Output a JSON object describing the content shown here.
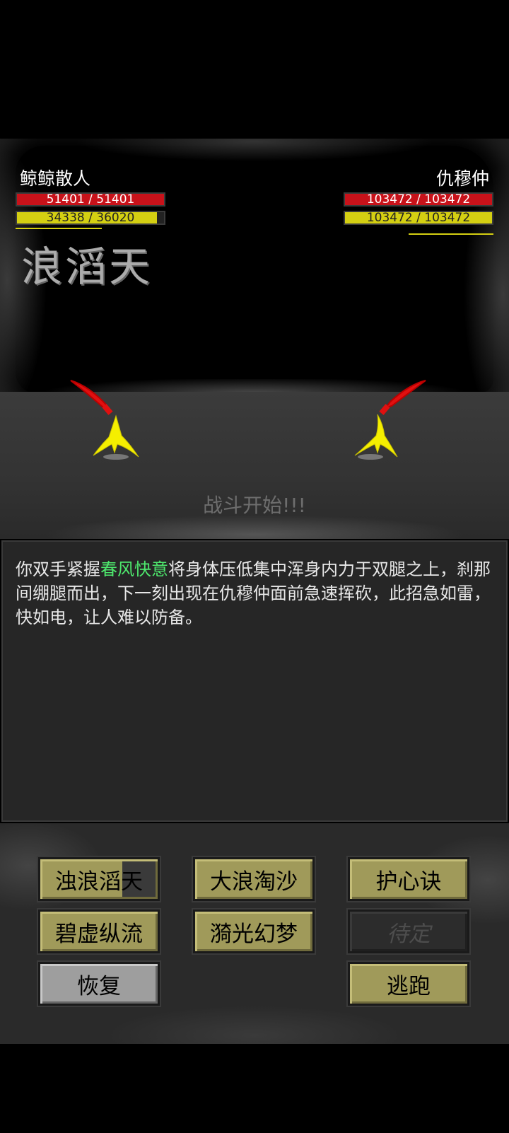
{
  "player": {
    "name": "鲸鲸散人",
    "hp": "51401 / 51401",
    "hp_fraction": 1.0,
    "mp": "34338 / 36020",
    "mp_fraction": 0.953,
    "colors": {
      "hp": "#c8121a",
      "mp": "#d4cf12"
    }
  },
  "enemy": {
    "name": "仇穆仲",
    "hp": "103472 / 103472",
    "hp_fraction": 1.0,
    "mp": "103472 / 103472",
    "mp_fraction": 1.0
  },
  "skill_banner": "浪滔天",
  "battle_status": "战斗开始!!!",
  "message": {
    "before": "你双手紧握",
    "highlight": "春风快意",
    "after": "将身体压低集中浑身内力于双腿之上，刹那间绷腿而出，下一刻出现在仇穆仲面前急速挥砍，此招急如雷，快如电，让人难以防备。",
    "highlight_color": "#4ee86d"
  },
  "buttons": {
    "skill1": "浊浪滔天",
    "skill2": "大浪淘沙",
    "skill3": "护心诀",
    "skill4": "碧虚纵流",
    "skill5": "漪光幻梦",
    "skill6": "待定",
    "recover": "恢复",
    "flee": "逃跑"
  },
  "icons": {
    "player_sprite": "yellow-swordsman-icon",
    "enemy_sprite": "yellow-swordsman-icon",
    "weapon": "red-sword-icon"
  }
}
